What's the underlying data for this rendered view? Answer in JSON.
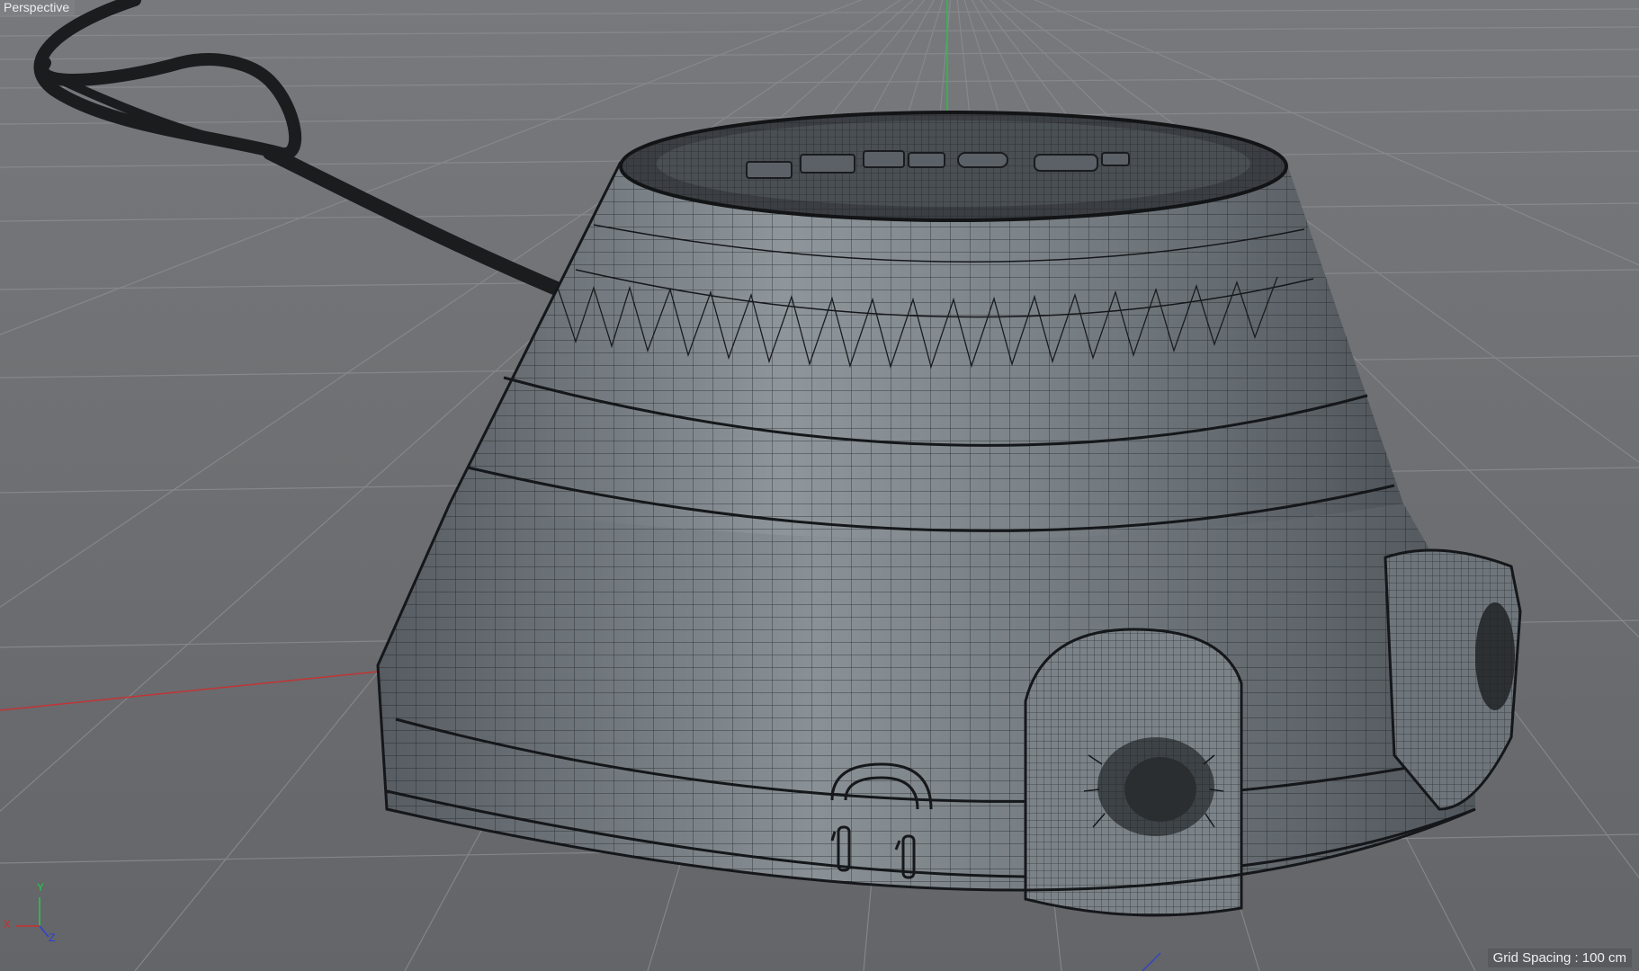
{
  "viewport": {
    "label": "Perspective",
    "grid_spacing": "Grid Spacing : 100 cm"
  },
  "axes": {
    "y": "Y",
    "x": "X",
    "z": "Z"
  },
  "colors": {
    "background": "#6f7174",
    "grid_line": "#8a8c8f",
    "model_surface": "#8a9095",
    "wire": "#1c1e20",
    "x_axis": "#c03030",
    "y_axis": "#20c040",
    "z_axis": "#3040c0"
  },
  "icons": [
    "axis-gizmo-icon"
  ]
}
